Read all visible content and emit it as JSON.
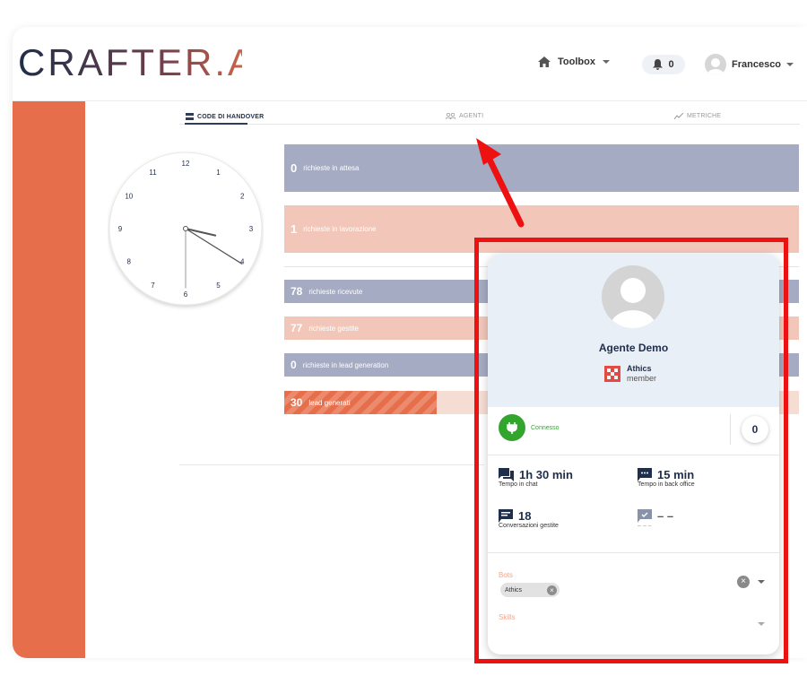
{
  "brand": {
    "logo_text": "CRAFTER.AI"
  },
  "header": {
    "toolbox_label": "Toolbox",
    "notifications_count": "0",
    "user_name": "Francesco"
  },
  "tabs": [
    {
      "label": "CODE DI HANDOVER",
      "active": true
    },
    {
      "label": "AGENTI",
      "active": false
    },
    {
      "label": "METRICHE",
      "active": false
    }
  ],
  "clock": {
    "numbers": [
      "12",
      "1",
      "2",
      "3",
      "4",
      "5",
      "6",
      "7",
      "8",
      "9",
      "10",
      "11"
    ],
    "hour_hand_angle_deg": 103,
    "minute_hand_angle_deg": 122,
    "second_hand_angle_deg": 180
  },
  "stats": [
    {
      "value": "0",
      "label": "richieste in attesa",
      "color": "#a5abc2"
    },
    {
      "value": "1",
      "label": "richieste in lavorazione",
      "color": "#f2c7b9"
    },
    {
      "value": "78",
      "label": "richieste ricevute",
      "color": "#a5abc2"
    },
    {
      "value": "77",
      "label": "richieste gestite",
      "color": "#f2c7b9"
    },
    {
      "value": "0",
      "label": "richieste in lead generation",
      "color": "#a5abc2"
    },
    {
      "value": "30",
      "label": "lead generati",
      "color": "#e66e4b",
      "progress_fraction": 0.3
    }
  ],
  "agent_card": {
    "name": "Agente Demo",
    "organization": "Athics",
    "role": "member",
    "status": "Connesso",
    "conversations_count": "0",
    "metrics": [
      {
        "value": "1h 30 min",
        "label": "Tempo in chat",
        "icon": "chat-icon"
      },
      {
        "value": "15 min",
        "label": "Tempo in back office",
        "icon": "message-dots-icon"
      },
      {
        "value": "18",
        "label": "Conversazioni gestite",
        "icon": "list-chat-icon"
      },
      {
        "value": "– –",
        "label": "– – –",
        "icon": "chat-check-icon"
      }
    ],
    "bots_label": "Bots",
    "bots_selected": [
      "Athics"
    ],
    "skills_label": "Skills"
  },
  "colors": {
    "accent": "#e66e4b",
    "navy": "#1f2e4a",
    "status_green": "#33a52f",
    "highlight_red": "#ee1111"
  }
}
